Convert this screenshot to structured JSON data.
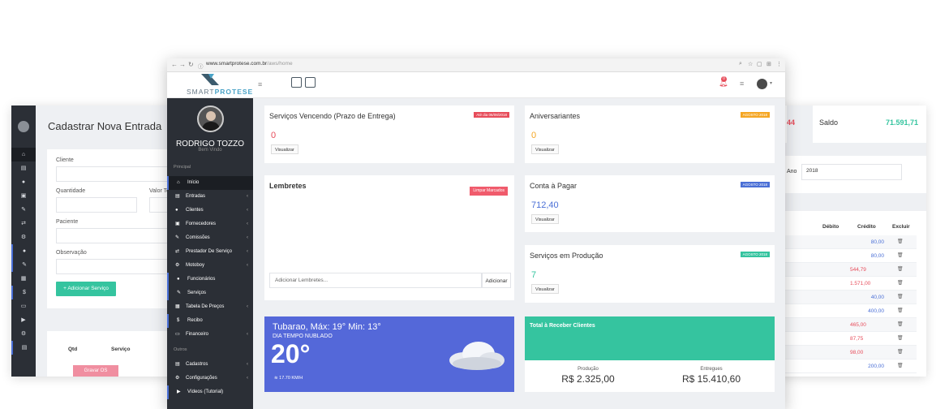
{
  "left_window": {
    "title": "Cadastrar Nova Entrada",
    "fields": {
      "cliente": "Cliente",
      "quantidade": "Quantidade",
      "valor_total": "Valor To",
      "paciente": "Paciente",
      "observacao": "Observação"
    },
    "add_service_button": "+ Adicionar Serviço",
    "table_headers": {
      "qtd": "Qtd",
      "servico": "Serviço"
    },
    "save_button": "Gravar OS",
    "sidebar_icons": [
      "home-icon",
      "file-icon",
      "user-icon",
      "briefcase-icon",
      "wrench-icon",
      "exchange-icon",
      "motorcycle-icon",
      "person-icon",
      "edit-icon",
      "table-icon",
      "dollar-icon",
      "money-icon",
      "video-icon",
      "gear-icon",
      "book-icon"
    ]
  },
  "right_window": {
    "partial_value": "44",
    "saldo_label": "Saldo",
    "saldo_value": "71.591,71",
    "ano_label": "Ano",
    "ano_value": "2018",
    "headers": {
      "debito": "Débito",
      "credito": "Crédito",
      "excluir": "Excluir"
    },
    "rows": [
      {
        "debito": "",
        "credito": "80,00"
      },
      {
        "debito": "",
        "credito": "80,00"
      },
      {
        "debito": "544,79",
        "credito": ""
      },
      {
        "debito": "1.571,00",
        "credito": ""
      },
      {
        "debito": "",
        "credito": "40,00"
      },
      {
        "debito": "",
        "credito": "400,00"
      },
      {
        "debito": "465,00",
        "credito": ""
      },
      {
        "debito": "87,75",
        "credito": ""
      },
      {
        "debito": "98,00",
        "credito": ""
      },
      {
        "debito": "",
        "credito": "200,00"
      }
    ]
  },
  "browser": {
    "url_host": "www.smartprotese.com.br",
    "url_path": "/aws/home",
    "logo_left": "SMART",
    "logo_right": "PROTESE",
    "notif_count": "0",
    "user": {
      "name": "RODRIGO TOZZO",
      "greeting": "Bem Vindo"
    },
    "sections": {
      "principal": "Principal",
      "outros": "Outros"
    },
    "menu": [
      {
        "icon": "home-icon",
        "label": "Início",
        "chevron": false
      },
      {
        "icon": "file-icon",
        "label": "Entradas",
        "chevron": true
      },
      {
        "icon": "user-icon",
        "label": "Clientes",
        "chevron": true
      },
      {
        "icon": "briefcase-icon",
        "label": "Fornecedores",
        "chevron": true
      },
      {
        "icon": "wrench-icon",
        "label": "Comissões",
        "chevron": true
      },
      {
        "icon": "exchange-icon",
        "label": "Prestador De Serviço",
        "chevron": true
      },
      {
        "icon": "motorcycle-icon",
        "label": "Motoboy",
        "chevron": true
      },
      {
        "icon": "person-icon",
        "label": "Funcionários",
        "chevron": false
      },
      {
        "icon": "edit-icon",
        "label": "Serviços",
        "chevron": false
      },
      {
        "icon": "table-icon",
        "label": "Tabela De Preços",
        "chevron": true
      },
      {
        "icon": "dollar-icon",
        "label": "Recibo",
        "chevron": false
      },
      {
        "icon": "money-icon",
        "label": "Financeiro",
        "chevron": true
      }
    ],
    "menu_outros": [
      {
        "icon": "book-icon",
        "label": "Cadastros",
        "chevron": true
      },
      {
        "icon": "gear-icon",
        "label": "Configurações",
        "chevron": true
      },
      {
        "icon": "video-icon",
        "label": "Vídeos (Tutorial)",
        "chevron": false
      }
    ],
    "cards": {
      "vencendo": {
        "title": "Serviços Vencendo (Prazo de Entrega)",
        "badge": "Até dia 06/08/2018",
        "value": "0",
        "button": "Visualizar"
      },
      "aniversariantes": {
        "title": "Aniversariantes",
        "badge": "AGOSTO 2018",
        "value": "0",
        "button": "Visualizar"
      },
      "lembretes": {
        "title": "Lembretes",
        "clear_button": "Limpar Marcados",
        "input_placeholder": "Adicionar Lembretes...",
        "add_button": "Adicionar"
      },
      "conta_pagar": {
        "title": "Conta à Pagar",
        "badge": "AGOSTO 2018",
        "value": "712,40",
        "button": "Visualizar"
      },
      "producao": {
        "title": "Serviços em Produção",
        "badge": "AGOSTO 2018",
        "value": "7",
        "button": "Visualizar"
      }
    },
    "weather": {
      "city": "Tubarao, Máx: 19°   Min: 13°",
      "desc": "DIA TEMPO NUBLADO",
      "temp": "20°",
      "wind": "17.70 KM/H"
    },
    "receber": {
      "title": "Total à Receber Clientes",
      "producao_label": "Produção",
      "producao_value": "R$ 2.325,00",
      "entregues_label": "Entregues",
      "entregues_value": "R$ 15.410,60"
    },
    "colors": {
      "red": "#e74c5a",
      "orange": "#f5a623",
      "blue": "#4a6fd6",
      "green": "#35c49f",
      "weather": "#5468d9",
      "sidebar": "#2b2f36"
    }
  }
}
